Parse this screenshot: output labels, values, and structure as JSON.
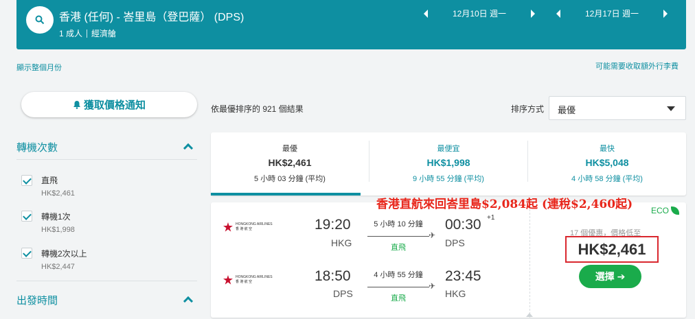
{
  "header": {
    "route": "香港 (任何) - 峇里島（登巴薩） (DPS)",
    "passengers": "1 成人",
    "cabin": "經濟艙",
    "depart_date": "12月10日 週一",
    "return_date": "12月17日 週一"
  },
  "links": {
    "show_month": "顯示整個月份",
    "extra_fees": "可能需要收取額外行李費"
  },
  "price_alert": {
    "label": "獲取價格通知"
  },
  "filters": {
    "stops_title": "轉機次數",
    "stops": [
      {
        "label": "直飛",
        "price": "HK$2,461"
      },
      {
        "label": "轉機1次",
        "price": "HK$1,998"
      },
      {
        "label": "轉機2次以上",
        "price": "HK$2,447"
      }
    ],
    "depart_time_title": "出發時間"
  },
  "results": {
    "count_text": "依最優排序的 921 個結果",
    "sort_label": "排序方式",
    "sort_value": "最優"
  },
  "tabs": [
    {
      "name": "最優",
      "price": "HK$2,461",
      "duration": "5 小時 03 分鐘 (平均)"
    },
    {
      "name": "最便宜",
      "price": "HK$1,998",
      "duration": "9 小時 55 分鐘 (平均)"
    },
    {
      "name": "最快",
      "price": "HK$5,048",
      "duration": "4 小時 58 分鐘 (平均)"
    }
  ],
  "annotation": "香港直航來回峇里島$2,084起 (連稅$2,460起)",
  "result_card": {
    "eco_label": "ECO",
    "deals_text": "17 個優惠，價格低至",
    "price": "HK$2,461",
    "select_label": "選擇 ➔",
    "airline": {
      "en": "HONGKONG AIRLINES",
      "zh": "香 港 航 空"
    },
    "outbound": {
      "dep_time": "19:20",
      "dep_airport": "HKG",
      "duration": "5 小時 10 分鐘",
      "stops": "直飛",
      "arr_time": "00:30",
      "arr_airport": "DPS",
      "day_offset": "+1"
    },
    "inbound": {
      "dep_time": "18:50",
      "dep_airport": "DPS",
      "duration": "4 小時 55 分鐘",
      "stops": "直飛",
      "arr_time": "23:45",
      "arr_airport": "HKG"
    }
  },
  "colors": {
    "brand": "#0e8fa1",
    "green": "#1aab4b",
    "highlight_red": "#d9272e"
  },
  "icons": {
    "search": "search-icon",
    "bell": "bell-icon",
    "plane": "plane-icon",
    "leaf": "leaf-icon"
  }
}
